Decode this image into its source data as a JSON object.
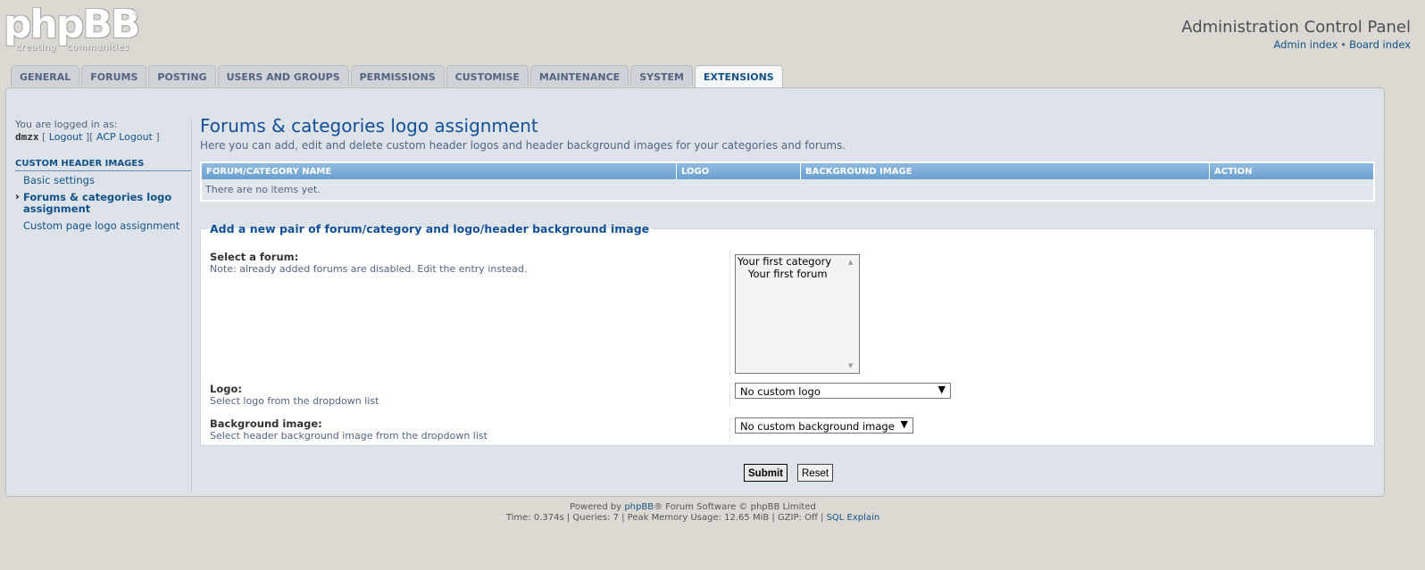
{
  "header": {
    "logo_text": "phpBB",
    "logo_tagline": "creating communities",
    "logo_reg": "®",
    "title": "Administration Control Panel",
    "links": {
      "admin_index": "Admin index",
      "separator": "•",
      "board_index": "Board index"
    }
  },
  "tabs": [
    {
      "label": "GENERAL"
    },
    {
      "label": "FORUMS"
    },
    {
      "label": "POSTING"
    },
    {
      "label": "USERS AND GROUPS"
    },
    {
      "label": "PERMISSIONS"
    },
    {
      "label": "CUSTOMISE"
    },
    {
      "label": "MAINTENANCE"
    },
    {
      "label": "SYSTEM"
    },
    {
      "label": "EXTENSIONS",
      "active": true
    }
  ],
  "sidebar": {
    "logged_in_label": "You are logged in as:",
    "username": "dmzx",
    "logout": "Logout",
    "acp_logout": "ACP Logout",
    "section_title": "CUSTOM HEADER IMAGES",
    "items": [
      {
        "label": "Basic settings"
      },
      {
        "label": "Forums & categories logo assignment",
        "active": true
      },
      {
        "label": "Custom page logo assignment"
      }
    ]
  },
  "main": {
    "title": "Forums & categories logo assignment",
    "description": "Here you can add, edit and delete custom header logos and header background images for your categories and forums.",
    "table": {
      "columns": [
        "FORUM/CATEGORY NAME",
        "LOGO",
        "BACKGROUND IMAGE",
        "ACTION"
      ],
      "empty_message": "There are no items yet."
    },
    "form": {
      "legend": "Add a new pair of forum/category and logo/header background image",
      "forum_label": "Select a forum:",
      "forum_note": "Note: already added forums are disabled. Edit the entry instead.",
      "forum_options": [
        "Your first category",
        "Your first forum"
      ],
      "logo_label": "Logo:",
      "logo_note": "Select logo from the dropdown list",
      "logo_value": "No custom logo",
      "bg_label": "Background image:",
      "bg_note": "Select header background image from the dropdown list",
      "bg_value": "No custom background image"
    },
    "submit_label": "Submit",
    "reset_label": "Reset"
  },
  "footer": {
    "powered_prefix": "Powered by",
    "powered_link": "phpBB",
    "powered_suffix": "® Forum Software © phpBB Limited",
    "stats": "Time: 0.374s | Queries: 7 | Peak Memory Usage: 12.65 MiB | GZIP: Off |",
    "sql_explain": "SQL Explain"
  }
}
